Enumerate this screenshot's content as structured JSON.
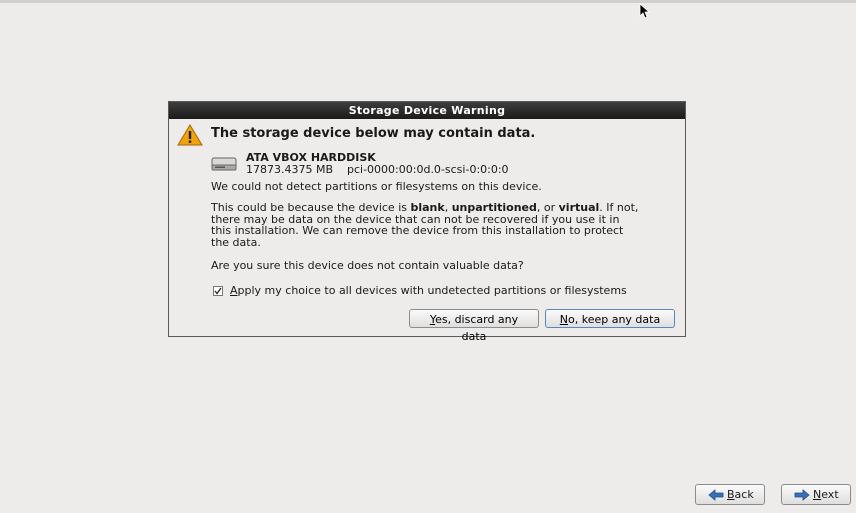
{
  "dialog": {
    "title": "Storage Device Warning",
    "headline": "The storage device below may contain data.",
    "device": {
      "name": "ATA VBOX HARDDISK",
      "size": "17873.4375 MB",
      "path": "pci-0000:00:0d.0-scsi-0:0:0:0"
    },
    "message1": "We could not detect partitions or filesystems on this device.",
    "message2": {
      "pre": "This could be because the device is ",
      "blank": "blank",
      "sep1": ", ",
      "unpartitioned": "unpartitioned",
      "sep2": ", or ",
      "virtual": "virtual",
      "post": ". If not, there may be data on the device that can not be recovered if you use it in this installation. We can remove the device from this installation to protect the data."
    },
    "question": "Are you sure this device does not contain valuable data?",
    "checkbox": {
      "mnemonic": "A",
      "label_rest": "pply my choice to all devices with undetected partitions or filesystems",
      "checked": true
    },
    "discard_button": {
      "mnemonic": "Y",
      "rest": "es, discard any data"
    },
    "keep_button": {
      "mnemonic": "N",
      "rest": "o, keep any data"
    }
  },
  "nav": {
    "back": {
      "mnemonic": "B",
      "rest": "ack"
    },
    "next": {
      "mnemonic": "N",
      "rest": "ext"
    }
  },
  "icons": {
    "warning": "warning-icon",
    "disk": "harddisk-icon",
    "back": "back-arrow-icon",
    "next": "next-arrow-icon"
  },
  "colors": {
    "background": "#edeceb",
    "titlebar": "#1b1b1b",
    "nav_arrow": "#3a6fb5",
    "warning": "#f0a30a"
  }
}
